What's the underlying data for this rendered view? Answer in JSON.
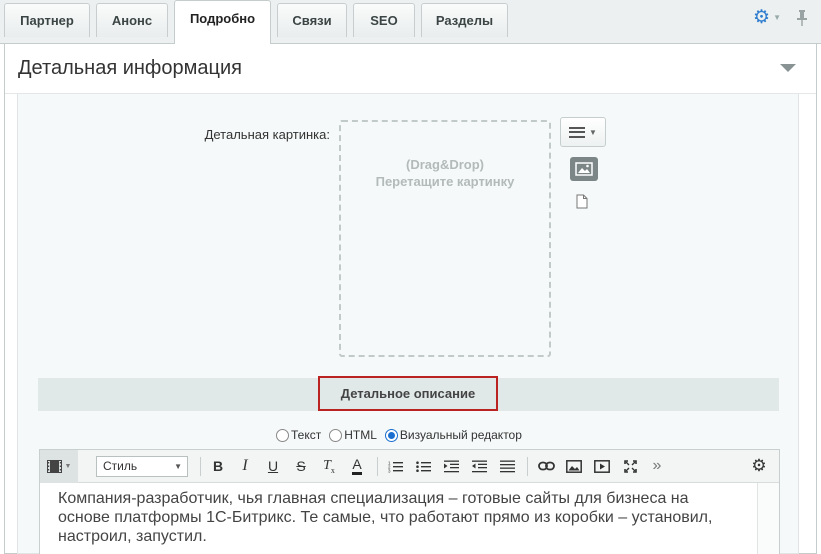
{
  "tabs": [
    {
      "label": "Партнер",
      "active": false
    },
    {
      "label": "Анонс",
      "active": false
    },
    {
      "label": "Подробно",
      "active": true
    },
    {
      "label": "Связи",
      "active": false
    },
    {
      "label": "SEO",
      "active": false
    },
    {
      "label": "Разделы",
      "active": false
    }
  ],
  "section": {
    "title": "Детальная информация"
  },
  "detail_image": {
    "label": "Детальная картинка:",
    "dropzone_line1": "(Drag&Drop)",
    "dropzone_line2": "Перетащите картинку"
  },
  "description": {
    "title": "Детальное описание",
    "modes": [
      {
        "label": "Текст",
        "checked": false
      },
      {
        "label": "HTML",
        "checked": false
      },
      {
        "label": "Визуальный редактор",
        "checked": true
      }
    ],
    "style_select": "Стиль",
    "text": "Компания-разработчик, чья главная специализация – готовые сайты для бизнеса на основе платформы 1С-Битрикс. Те самые, что работают прямо из коробки – установил, настроил, запустил."
  },
  "colors": {
    "accent": "#2f7dcf",
    "highlight_border": "#bb2222"
  }
}
